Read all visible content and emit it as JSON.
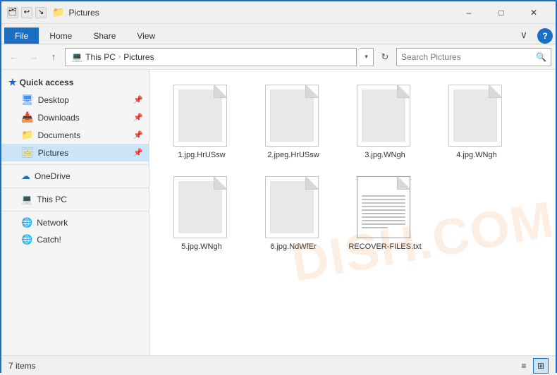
{
  "titleBar": {
    "title": "Pictures",
    "iconLabel": "folder",
    "minimize": "–",
    "maximize": "□",
    "close": "✕"
  },
  "ribbon": {
    "tabs": [
      "File",
      "Home",
      "Share",
      "View"
    ],
    "activeTab": "File",
    "chevron": "∨",
    "help": "?"
  },
  "addressBar": {
    "back": "←",
    "forward": "→",
    "up": "↑",
    "path": {
      "segments": [
        "This PC",
        "Pictures"
      ]
    },
    "refresh": "↻",
    "searchPlaceholder": "Search Pictures",
    "searchIcon": "🔍"
  },
  "sidebar": {
    "quickAccess": "Quick access",
    "items": [
      {
        "label": "Desktop",
        "icon": "desktop",
        "pinned": true
      },
      {
        "label": "Downloads",
        "icon": "yellow",
        "pinned": true
      },
      {
        "label": "Documents",
        "icon": "yellow",
        "pinned": true
      },
      {
        "label": "Pictures",
        "icon": "yellow",
        "pinned": true,
        "active": true
      }
    ],
    "oneDrive": "OneDrive",
    "thisPC": "This PC",
    "network": "Network",
    "catch": "Catch!"
  },
  "files": [
    {
      "name": "1.jpg.HrUSsw",
      "type": "image"
    },
    {
      "name": "2.jpeg.HrUSsw",
      "type": "image"
    },
    {
      "name": "3.jpg.WNgh",
      "type": "image"
    },
    {
      "name": "4.jpg.WNgh",
      "type": "image"
    },
    {
      "name": "5.jpg.WNgh",
      "type": "image"
    },
    {
      "name": "6.jpg.NdWfEr",
      "type": "image"
    },
    {
      "name": "RECOVER-FILES.txt",
      "type": "text"
    }
  ],
  "statusBar": {
    "itemCount": "7 items"
  }
}
